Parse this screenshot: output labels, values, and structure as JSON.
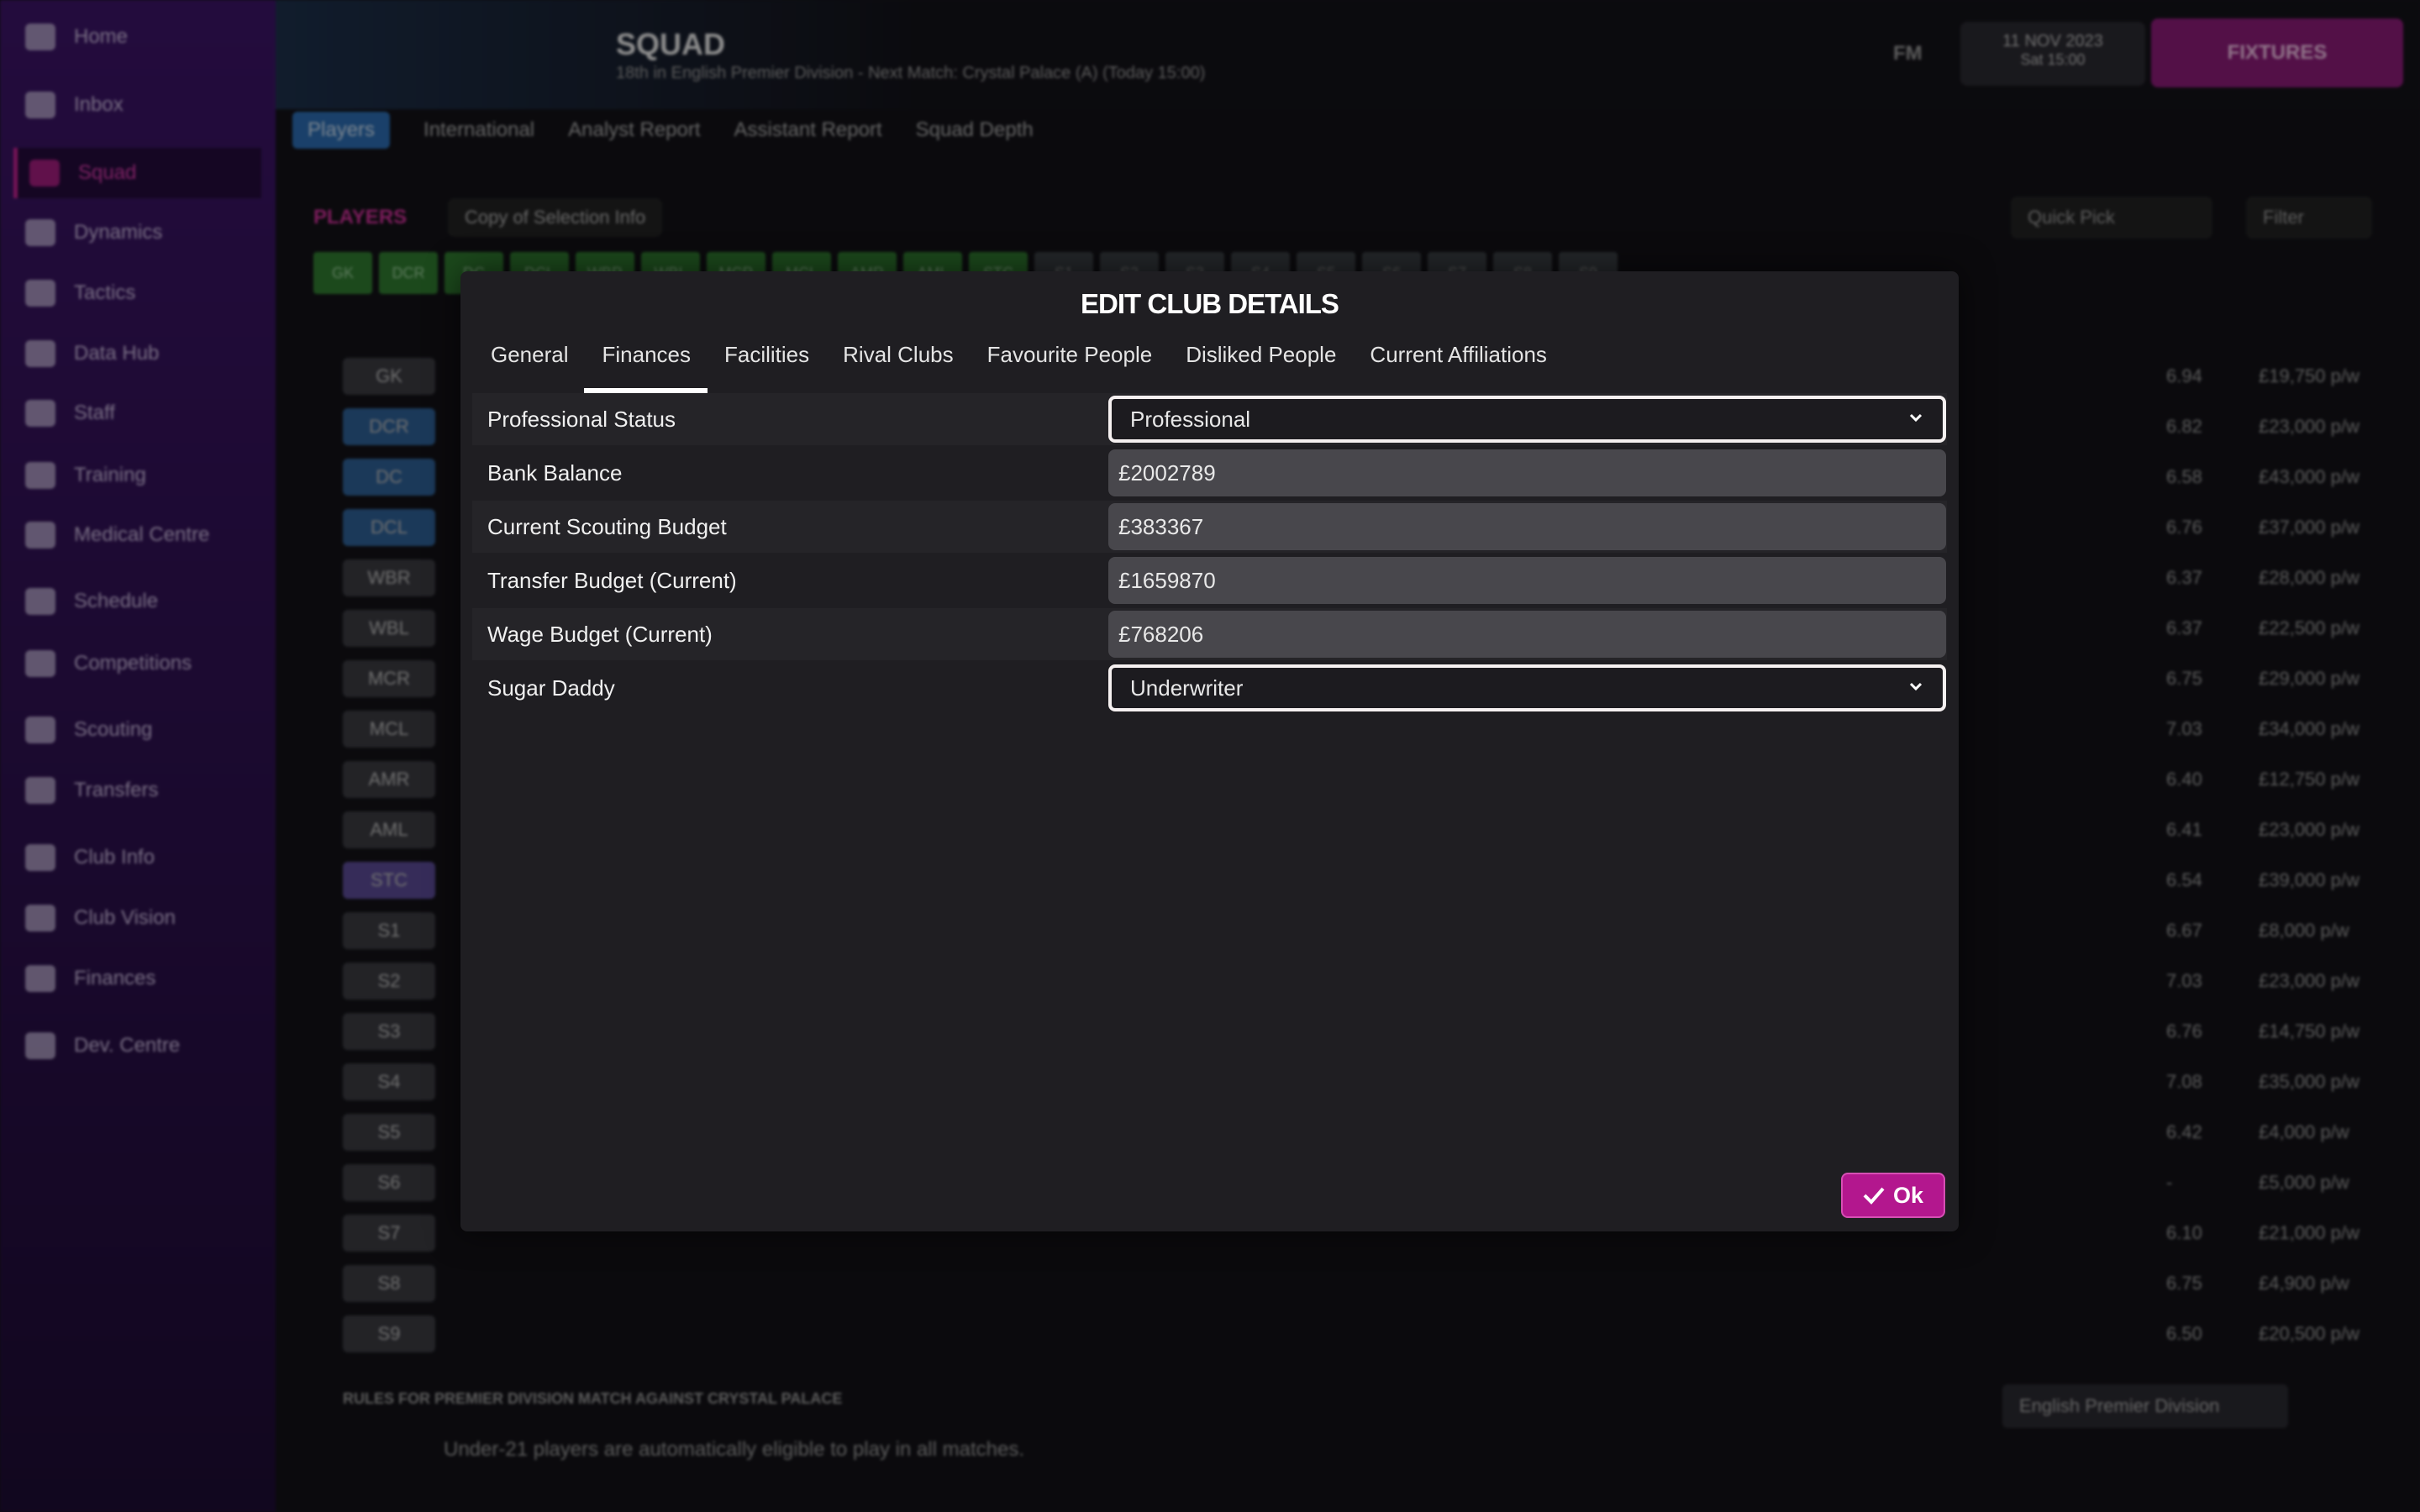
{
  "sidebar": {
    "items": [
      {
        "label": "Home",
        "icon": "home-icon"
      },
      {
        "label": "Inbox",
        "icon": "inbox-icon"
      },
      {
        "label": "Squad",
        "icon": "shirt-icon",
        "active": true
      },
      {
        "label": "Dynamics",
        "icon": "dynamics-icon"
      },
      {
        "label": "Tactics",
        "icon": "tactics-icon"
      },
      {
        "label": "Data Hub",
        "icon": "data-hub-icon"
      },
      {
        "label": "Staff",
        "icon": "staff-icon"
      },
      {
        "label": "Training",
        "icon": "training-icon"
      },
      {
        "label": "Medical Centre",
        "icon": "medical-icon"
      },
      {
        "label": "Schedule",
        "icon": "calendar-icon"
      },
      {
        "label": "Competitions",
        "icon": "trophy-icon"
      },
      {
        "label": "Scouting",
        "icon": "scouting-icon"
      },
      {
        "label": "Transfers",
        "icon": "transfers-icon"
      },
      {
        "label": "Club Info",
        "icon": "club-info-icon"
      },
      {
        "label": "Club Vision",
        "icon": "club-vision-icon"
      },
      {
        "label": "Finances",
        "icon": "finances-icon"
      },
      {
        "label": "Dev. Centre",
        "icon": "dev-centre-icon"
      }
    ]
  },
  "header": {
    "title": "SQUAD",
    "subtitle": "18th in English Premier Division - Next Match: Crystal Palace (A) (Today 15:00)",
    "fm": "FM",
    "date": "11 NOV 2023",
    "day": "Sat 15:00",
    "fixtures": "FIXTURES"
  },
  "subtabs": [
    "Players",
    "International",
    "Analyst Report",
    "Assistant Report",
    "Squad Depth"
  ],
  "players_label": "PLAYERS",
  "selection_info": "Copy of Selection Info",
  "quick_pick": "Quick Pick",
  "filter": "Filter",
  "positions": [
    "GK",
    "DCR",
    "DC",
    "DCL",
    "WBR",
    "WBL",
    "MCR",
    "MCL",
    "AMR",
    "AML",
    "STC",
    "S1",
    "S2",
    "S3",
    "S4",
    "S5",
    "S6",
    "S7",
    "S8",
    "S9"
  ],
  "wages": [
    "£19,750 p/w",
    "£23,000 p/w",
    "£43,000 p/w",
    "£37,000 p/w",
    "£28,000 p/w",
    "£22,500 p/w",
    "£29,000 p/w",
    "£34,000 p/w",
    "£12,750 p/w",
    "£23,000 p/w",
    "£39,000 p/w",
    "£8,000 p/w",
    "£23,000 p/w",
    "£14,750 p/w",
    "£35,000 p/w",
    "£4,000 p/w",
    "£5,000 p/w",
    "£21,000 p/w",
    "£4,900 p/w",
    "£20,500 p/w"
  ],
  "ratings": [
    "6.94",
    "6.82",
    "6.58",
    "6.76",
    "6.37",
    "6.37",
    "6.75",
    "7.03",
    "6.40",
    "6.41",
    "6.54",
    "6.67",
    "7.03",
    "6.76",
    "7.08",
    "6.42",
    "-",
    "6.10",
    "6.75",
    "6.50"
  ],
  "footer": {
    "rules": "RULES FOR PREMIER DIVISION MATCH AGAINST CRYSTAL PALACE",
    "note": "Under-21 players are automatically eligible to play in all matches.",
    "competition": "English Premier Division"
  },
  "modal": {
    "title": "EDIT CLUB DETAILS",
    "tabs": [
      "General",
      "Finances",
      "Facilities",
      "Rival Clubs",
      "Favourite People",
      "Disliked People",
      "Current Affiliations"
    ],
    "active_tab": "Finances",
    "fields": [
      {
        "label": "Professional Status",
        "value": "Professional",
        "type": "select"
      },
      {
        "label": "Bank Balance",
        "value": "£2002789",
        "type": "input"
      },
      {
        "label": "Current Scouting Budget",
        "value": "£383367",
        "type": "input"
      },
      {
        "label": "Transfer Budget (Current)",
        "value": "£1659870",
        "type": "input"
      },
      {
        "label": "Wage Budget (Current)",
        "value": "£768206",
        "type": "input"
      },
      {
        "label": "Sugar Daddy",
        "value": "Underwriter",
        "type": "select"
      }
    ],
    "ok_label": "Ok"
  },
  "colors": {
    "accent": "#b3178e",
    "sidebar": "#3b1466",
    "modal_bg": "#1f1e22"
  }
}
